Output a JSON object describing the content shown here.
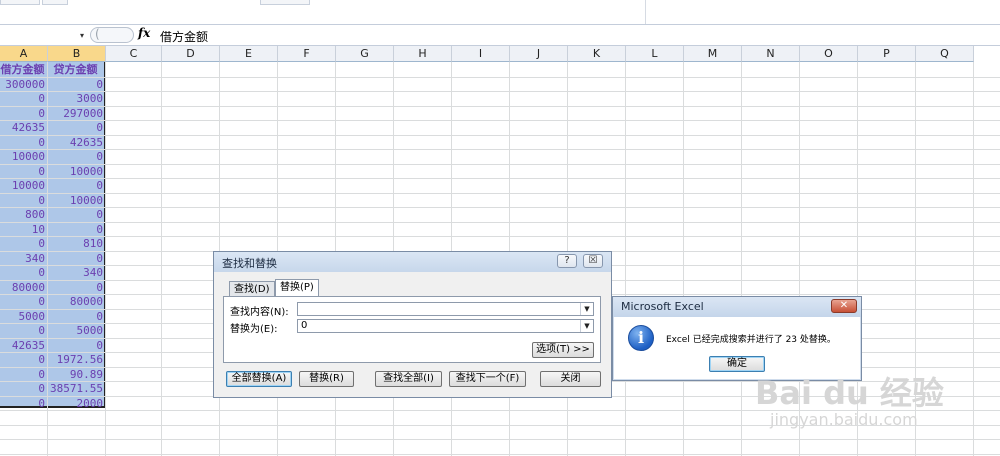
{
  "formula_bar": {
    "fx_label": "fx",
    "content": "借方金额",
    "namebox_dropdown": "▾",
    "ctrl_glyph": "("
  },
  "columns": [
    "A",
    "B",
    "C",
    "D",
    "E",
    "F",
    "G",
    "H",
    "I",
    "J",
    "K",
    "L",
    "M",
    "N",
    "O",
    "P",
    "Q"
  ],
  "sheet": {
    "header_a": "借方金额",
    "header_b": "贷方金额",
    "rows": [
      [
        "300000",
        "0"
      ],
      [
        "0",
        "3000"
      ],
      [
        "0",
        "297000"
      ],
      [
        "42635",
        "0"
      ],
      [
        "0",
        "42635"
      ],
      [
        "10000",
        "0"
      ],
      [
        "0",
        "10000"
      ],
      [
        "10000",
        "0"
      ],
      [
        "0",
        "10000"
      ],
      [
        "800",
        "0"
      ],
      [
        "10",
        "0"
      ],
      [
        "0",
        "810"
      ],
      [
        "340",
        "0"
      ],
      [
        "0",
        "340"
      ],
      [
        "80000",
        "0"
      ],
      [
        "0",
        "80000"
      ],
      [
        "5000",
        "0"
      ],
      [
        "0",
        "5000"
      ],
      [
        "42635",
        "0"
      ],
      [
        "0",
        "1972.56"
      ],
      [
        "0",
        "90.89"
      ],
      [
        "0",
        "38571.55"
      ],
      [
        "0",
        "2000"
      ]
    ]
  },
  "find_replace": {
    "title": "查找和替换",
    "help": "?",
    "close": "☒",
    "tab_find": "查找(D)",
    "tab_replace": "替换(P)",
    "find_label": "查找内容(N):",
    "find_value": "",
    "replace_label": "替换为(E):",
    "replace_value": "0",
    "options_button": "选项(T) >>",
    "replace_all": "全部替换(A)",
    "replace": "替换(R)",
    "find_all": "查找全部(I)",
    "find_next": "查找下一个(F)",
    "close_button": "关闭"
  },
  "message_box": {
    "title": "Microsoft Excel",
    "close": "✕",
    "message": "Excel 已经完成搜索并进行了 23 处替换。",
    "ok": "确定",
    "icon": "info-icon",
    "icon_glyph": "i"
  },
  "watermark": {
    "brand": "Bai du 经验",
    "url": "jingyan.baidu.com"
  }
}
